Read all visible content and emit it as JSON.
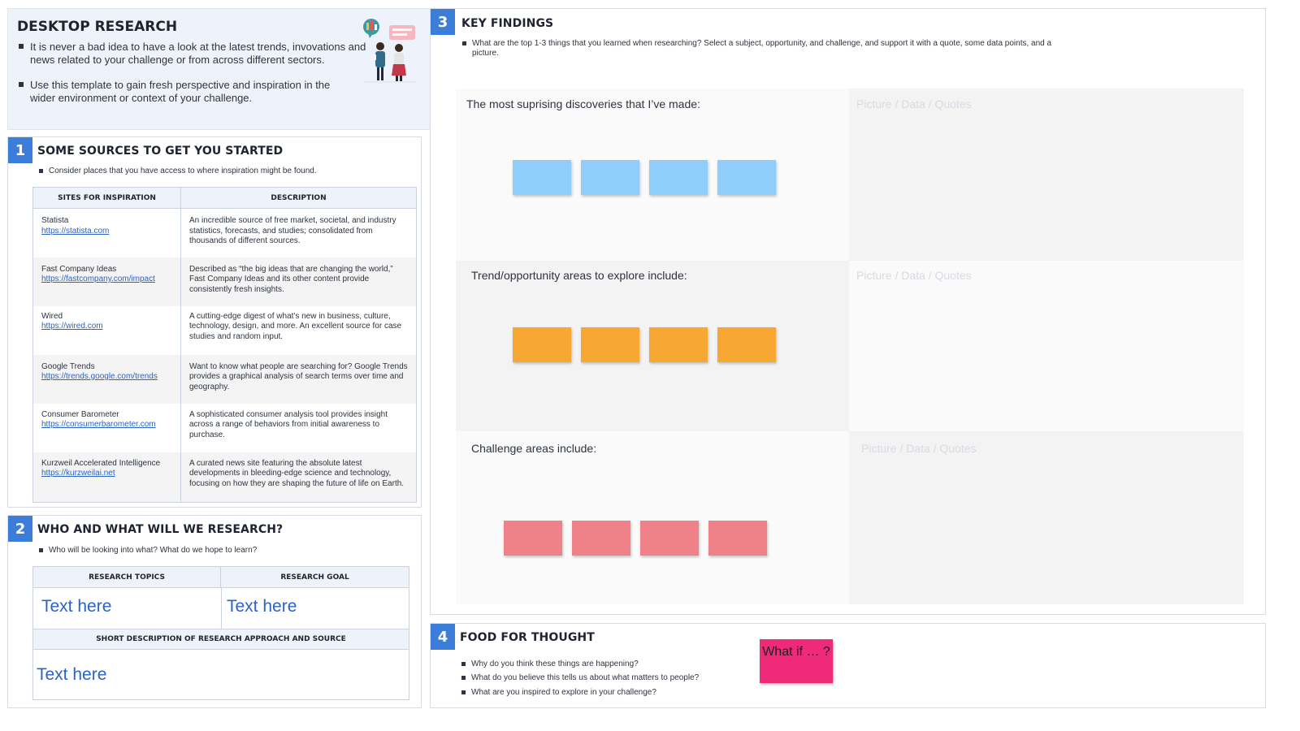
{
  "intro": {
    "title": "DESKTOP RESEARCH",
    "bullets": [
      "It is never a bad idea to have a look at the latest trends, invovations and news related to your challenge or from across different sectors.",
      "Use this template to gain fresh perspective and inspiration in the wider environment or context of your challenge."
    ],
    "illustration_icon": "people-with-chat-bubbles-illustration"
  },
  "section1": {
    "number": "1",
    "title": "SOME SOURCES TO GET YOU STARTED",
    "bullet": "Consider places that you have access to where inspiration might be found.",
    "table": {
      "headers": [
        "SITES FOR INSPIRATION",
        "DESCRIPTION"
      ],
      "rows": [
        {
          "site": "Statista",
          "url": "https://statista.com",
          "description": "An incredible source of free market, societal, and industry statistics, forecasts, and studies; consolidated from thousands of different sources."
        },
        {
          "site": "Fast Company Ideas",
          "url": "https://fastcompany.com/impact",
          "description": "Described as “the big ideas that are changing the world,” Fast Company Ideas and its other content provide consistently fresh insights."
        },
        {
          "site": "Wired",
          "url": "https://wired.com",
          "description": "A cutting-edge digest of what's new in business, culture, technology, design, and more. An excellent source for case studies and random input."
        },
        {
          "site": "Google Trends",
          "url": "https://trends.google.com/trends",
          "description": "Want to know what people are searching for? Google Trends provides a graphical analysis of search terms over time and geography."
        },
        {
          "site": "Consumer Barometer",
          "url": "https://consumerbarometer.com",
          "description": "A sophisticated consumer analysis tool provides insight across a range of behaviors from initial awareness to purchase."
        },
        {
          "site": "Kurzweil Accelerated Intelligence",
          "url": "https://kurzweilai.net",
          "description": "A curated news site featuring the absolute latest developments in bleeding-edge science and technology, focusing on how they are shaping the future of life on Earth."
        }
      ]
    }
  },
  "section2": {
    "number": "2",
    "title": "WHO AND WHAT WILL WE RESEARCH?",
    "bullet": "Who will be looking into what? What do we hope to learn?",
    "headers": {
      "topics": "RESEARCH TOPICS",
      "goal": "RESEARCH GOAL",
      "description": "SHORT DESCRIPTION OF RESEARCH APPROACH AND SOURCE"
    },
    "values": {
      "topics": "Text here",
      "goal": "Text here",
      "description": "Text here"
    }
  },
  "section3": {
    "number": "3",
    "title": "KEY FINDINGS",
    "bullet": "What are the top 1-3 things that you learned when researching? Select a subject, opportunity, and challenge, and support it with a quote, some data points, and a picture.",
    "rows": [
      {
        "label": "The most suprising discoveries that I’ve made:",
        "side": "Picture / Data / Quotes",
        "color": "#8fcefa"
      },
      {
        "label": "Trend/opportunity areas to explore include:",
        "side": "Picture / Data / Quotes",
        "color": "#f6a833"
      },
      {
        "label": "Challenge areas include:",
        "side": "Picture / Data / Quotes",
        "color": "#ef8288"
      }
    ]
  },
  "section4": {
    "number": "4",
    "title": "FOOD FOR THOUGHT",
    "bullets": [
      "Why do you think these things are happening?",
      "What do you believe this tells us about what matters to people?",
      "What are you inspired to explore in your challenge?"
    ],
    "sticky": "What if … ?"
  }
}
